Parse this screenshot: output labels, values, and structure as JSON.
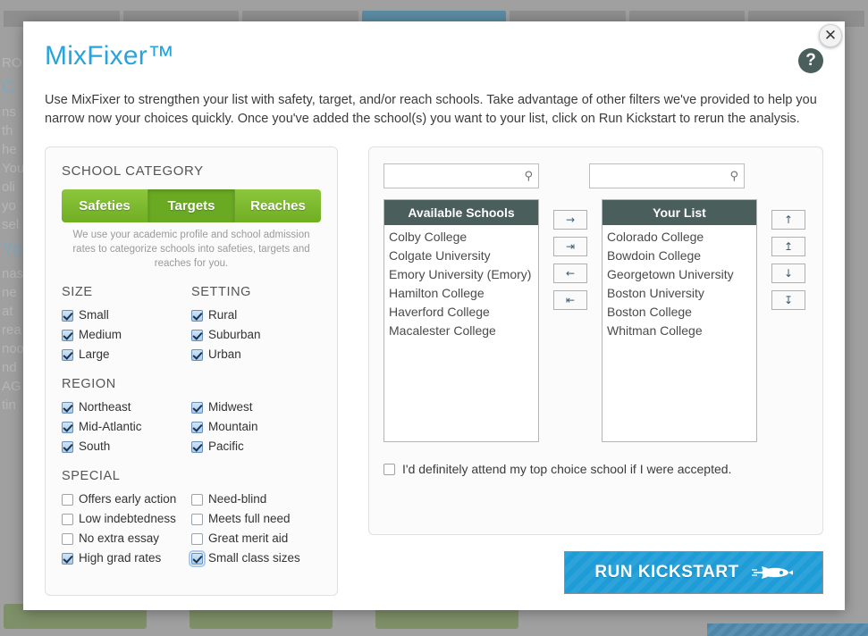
{
  "background": {
    "tabs": [
      "tab-1",
      "tab-2",
      "tab-3",
      "tab-4-active",
      "tab-5",
      "tab-6",
      "tab-7"
    ],
    "left_text_lines": [
      "RO",
      "C",
      "ns",
      "th",
      "he",
      "You",
      "oli",
      "yo",
      "sel",
      "Yo",
      "nas",
      "ne",
      "at",
      "rea",
      "noo",
      "nd",
      "AG",
      "tin"
    ]
  },
  "modal": {
    "title": "MixFixer™",
    "description": "Use MixFixer to strengthen your list with safety, target, and/or reach schools. Take advantage of other filters we've provided to help you narrow now your choices quickly. Once you've added the school(s) you want to your list, click on Run Kickstart to rerun the analysis.",
    "close_label": "✕",
    "help_label": "?"
  },
  "school_category": {
    "heading": "SCHOOL CATEGORY",
    "buttons": [
      {
        "label": "Safeties",
        "active": false
      },
      {
        "label": "Targets",
        "active": true
      },
      {
        "label": "Reaches",
        "active": false
      }
    ],
    "note": "We use your academic profile and school admission rates to categorize schools into safeties, targets and reaches for you."
  },
  "filters": [
    {
      "heading": "SIZE",
      "second_heading": "SETTING",
      "left": [
        {
          "label": "Small",
          "checked": true
        },
        {
          "label": "Medium",
          "checked": true
        },
        {
          "label": "Large",
          "checked": true
        }
      ],
      "right": [
        {
          "label": "Rural",
          "checked": true
        },
        {
          "label": "Suburban",
          "checked": true
        },
        {
          "label": "Urban",
          "checked": true
        }
      ]
    },
    {
      "heading": "REGION",
      "second_heading": "",
      "left": [
        {
          "label": "Northeast",
          "checked": true
        },
        {
          "label": "Mid-Atlantic",
          "checked": true
        },
        {
          "label": "South",
          "checked": true
        }
      ],
      "right": [
        {
          "label": "Midwest",
          "checked": true
        },
        {
          "label": "Mountain",
          "checked": true
        },
        {
          "label": "Pacific",
          "checked": true
        }
      ]
    },
    {
      "heading": "SPECIAL",
      "second_heading": "",
      "left": [
        {
          "label": "Offers early action",
          "checked": false
        },
        {
          "label": "Low indebtedness",
          "checked": false
        },
        {
          "label": "No extra essay",
          "checked": false
        },
        {
          "label": "High grad rates",
          "checked": true
        }
      ],
      "right": [
        {
          "label": "Need-blind",
          "checked": false
        },
        {
          "label": "Meets full need",
          "checked": false
        },
        {
          "label": "Great merit aid",
          "checked": false
        },
        {
          "label": "Small class sizes",
          "checked": true,
          "focused": true
        }
      ]
    }
  ],
  "search": {
    "available_value": "",
    "available_placeholder": "",
    "yourlist_value": "",
    "yourlist_placeholder": "",
    "icon": "search-icon"
  },
  "available_schools": {
    "header": "Available Schools",
    "items": [
      "Colby College",
      "Colgate University",
      "Emory University (Emory)",
      "Hamilton College",
      "Haverford College",
      "Macalester College"
    ]
  },
  "your_list": {
    "header": "Your List",
    "items": [
      "Colorado College",
      "Bowdoin College",
      "Georgetown University",
      "Boston University",
      "Boston College",
      "Whitman College"
    ]
  },
  "transfer_buttons": [
    {
      "name": "move-right",
      "glyph": "→"
    },
    {
      "name": "move-all-right",
      "glyph": "⇥"
    },
    {
      "name": "move-left",
      "glyph": "←"
    },
    {
      "name": "move-all-left",
      "glyph": "⇤"
    }
  ],
  "order_buttons": [
    {
      "name": "move-up",
      "glyph": "↑"
    },
    {
      "name": "move-to-top",
      "glyph": "↥"
    },
    {
      "name": "move-down",
      "glyph": "↓"
    },
    {
      "name": "move-to-bottom",
      "glyph": "↧"
    }
  ],
  "attend_checkbox": {
    "label": "I'd definitely attend my top choice school if I were accepted.",
    "checked": false
  },
  "run_button": {
    "label": "RUN KICKSTART",
    "icon": "rocket-icon"
  },
  "colors": {
    "title_blue": "#29a3dc",
    "green": "#8cc63e",
    "green_active": "#6aaa23",
    "header_teal": "#4a5f5c",
    "run_blue": "#1e9cd7"
  }
}
